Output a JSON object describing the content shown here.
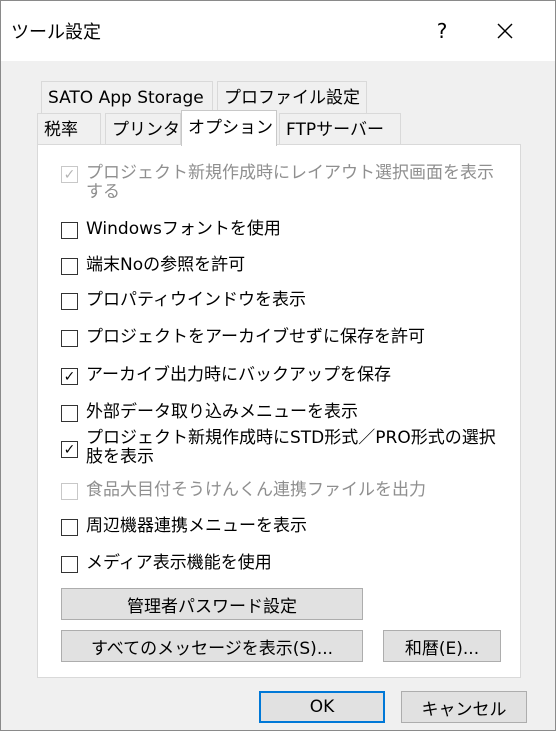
{
  "title": "ツール設定",
  "help_label": "?",
  "tabs_row1": [
    "SATO App Storage",
    "プロファイル設定"
  ],
  "tabs_row2": [
    "税率",
    "プリンタ",
    "オプション",
    "FTPサーバー"
  ],
  "options": [
    {
      "label": "プロジェクト新規作成時にレイアウト選択画面を表示する",
      "checked": true,
      "disabled": true
    },
    {
      "label": "Windowsフォントを使用",
      "checked": false,
      "disabled": false
    },
    {
      "label": "端末Noの参照を許可",
      "checked": false,
      "disabled": false
    },
    {
      "label": "プロパティウインドウを表示",
      "checked": false,
      "disabled": false
    },
    {
      "label": "プロジェクトをアーカイブせずに保存を許可",
      "checked": false,
      "disabled": false
    },
    {
      "label": "アーカイブ出力時にバックアップを保存",
      "checked": true,
      "disabled": false
    },
    {
      "label": "外部データ取り込みメニューを表示",
      "checked": false,
      "disabled": false
    },
    {
      "label": "プロジェクト新規作成時にSTD形式／PRO形式の選択肢を表示",
      "checked": true,
      "disabled": false
    },
    {
      "label": "食品大目付そうけんくん連携ファイルを出力",
      "checked": false,
      "disabled": true
    },
    {
      "label": "周辺機器連携メニューを表示",
      "checked": false,
      "disabled": false
    },
    {
      "label": "メディア表示機能を使用",
      "checked": false,
      "disabled": false
    }
  ],
  "buttons": {
    "admin_password": "管理者パスワード設定",
    "show_all_messages": "すべてのメッセージを表示(S)...",
    "wareki": "和暦(E)...",
    "ok": "OK",
    "cancel": "キャンセル"
  }
}
